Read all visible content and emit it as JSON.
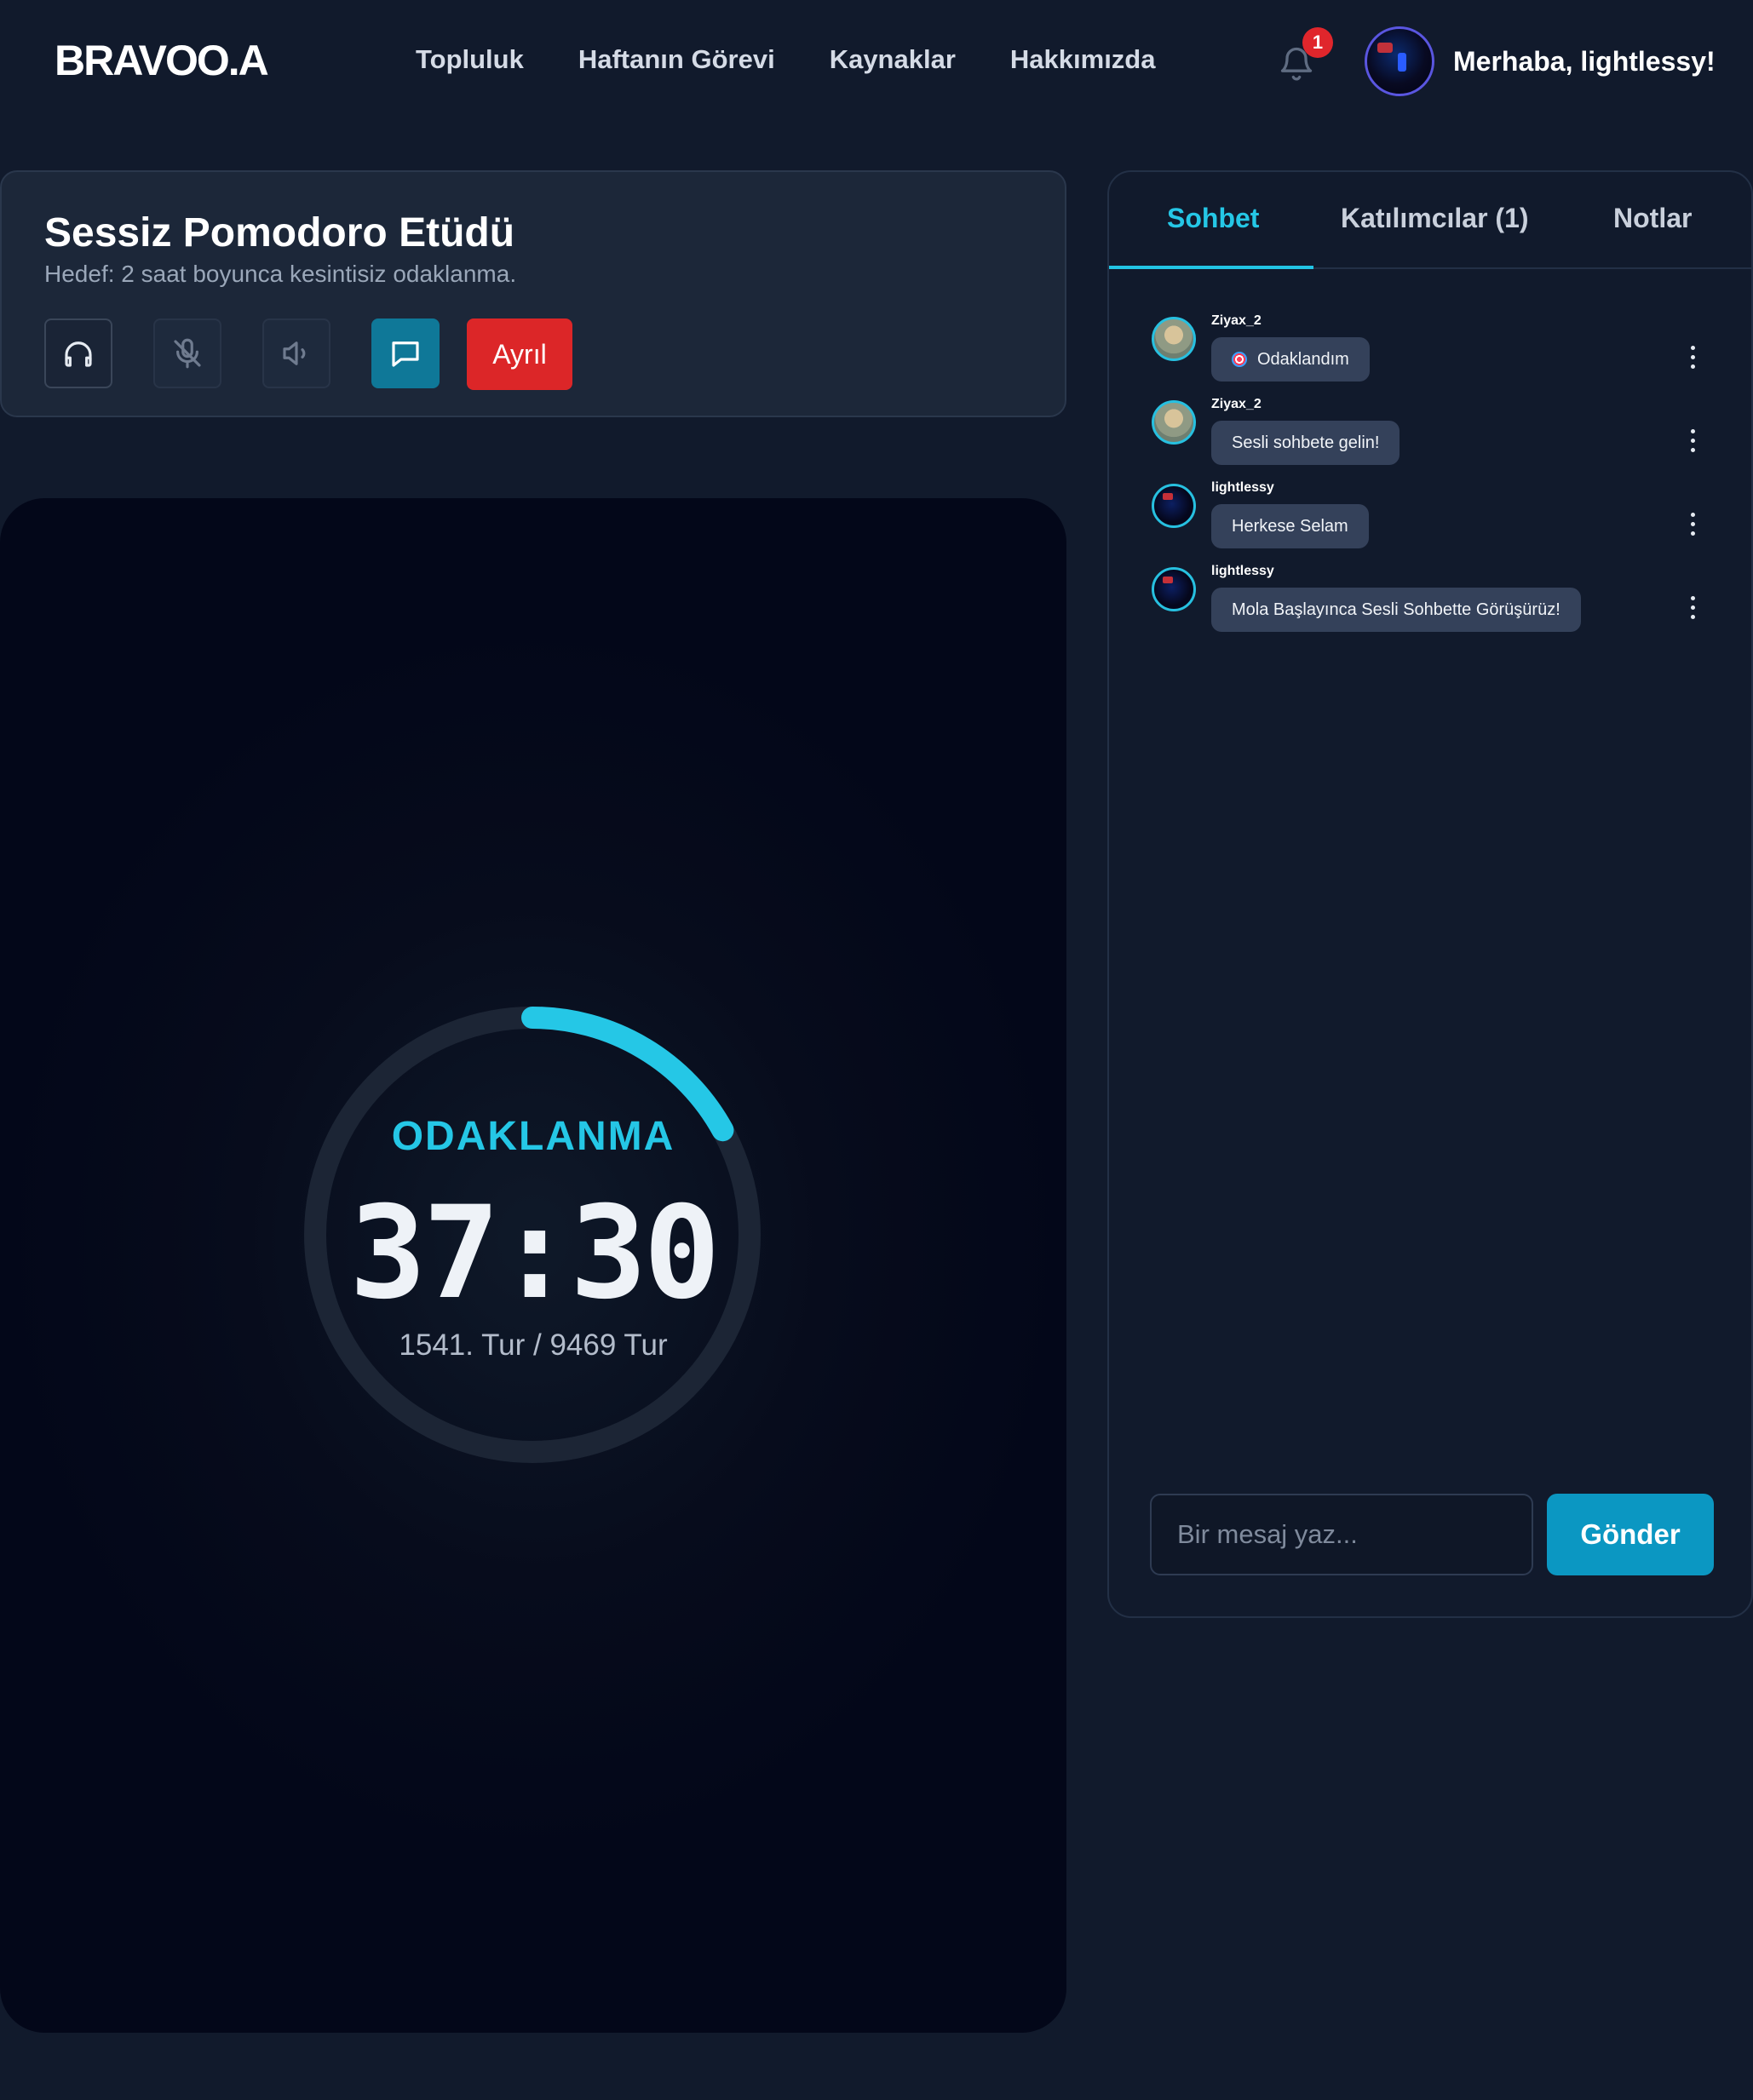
{
  "navbar": {
    "logo": "BRAVOO.A",
    "links": [
      "Topluluk",
      "Haftanın Görevi",
      "Kaynaklar",
      "Hakkımızda"
    ],
    "notification_count": "1",
    "greeting": "Merhaba, lightlessy!"
  },
  "room": {
    "title": "Sessiz Pomodoro Etüdü",
    "goal": "Hedef: 2 saat boyunca kesintisiz odaklanma.",
    "leave_label": "Ayrıl",
    "controls": [
      "headphones-icon",
      "mic-off-icon",
      "speaker-icon",
      "chat-icon"
    ]
  },
  "timer": {
    "phase": "ODAKLANMA",
    "time": "37:30",
    "round": "1541. Tur / 9469 Tur",
    "progress": 0.17
  },
  "side": {
    "tabs": [
      "Sohbet",
      "Katılımcılar (1)",
      "Notlar"
    ],
    "active_tab": "Sohbet",
    "messages": [
      {
        "user": "Ziyax_2",
        "text": "Odaklandım"
      },
      {
        "user": "Ziyax_2",
        "text": "Sesli sohbete gelin!"
      },
      {
        "user": "lightlessy",
        "text": "Herkese Selam"
      },
      {
        "user": "lightlessy",
        "text": "Mola Başlayınca Sesli Sohbette Görüşürüz!"
      }
    ],
    "input_placeholder": "Bir mesaj yaz...",
    "send_label": "Gönder"
  },
  "colors": {
    "accent": "#25c7e6",
    "danger": "#dc2628",
    "background": "#111a2c"
  }
}
